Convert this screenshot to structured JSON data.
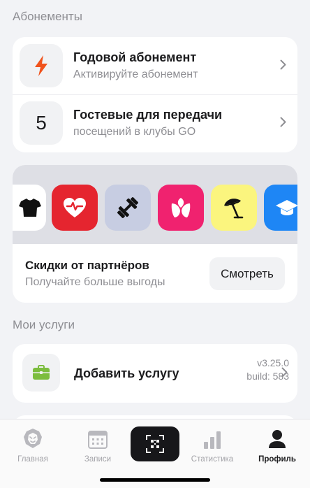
{
  "sections": {
    "subscriptions_title": "Абонементы",
    "services_title": "Мои услуги"
  },
  "subscriptions": [
    {
      "title": "Годовой абонемент",
      "subtitle": "Активируйте абонемент",
      "icon": "lightning-icon"
    },
    {
      "badge": "5",
      "title": "Гостевые для передачи",
      "subtitle": "посещений в клубы GO"
    }
  ],
  "partners": {
    "tiles": [
      {
        "icon": "tshirt-icon",
        "color": "#ffffff"
      },
      {
        "icon": "heart-pulse-icon",
        "color": "#e5252f"
      },
      {
        "icon": "dumbbell-icon",
        "color": "#c7cde2"
      },
      {
        "icon": "flower-icon",
        "color": "#f0226f"
      },
      {
        "icon": "beach-umbrella-icon",
        "color": "#fbf57e"
      },
      {
        "icon": "graduation-cap-icon",
        "color": "#1e86f5"
      }
    ],
    "title": "Скидки от партнёров",
    "subtitle": "Получайте больше выгоды",
    "button": "Смотреть"
  },
  "service": {
    "title": "Добавить услугу",
    "version": "v3.25.0",
    "build": "build: 583",
    "icon": "briefcase-icon"
  },
  "tabbar": {
    "items": [
      {
        "label": "Главная",
        "icon": "lion-icon",
        "active": false
      },
      {
        "label": "Записи",
        "icon": "calendar-icon",
        "active": false
      },
      {
        "label": "",
        "icon": "qr-scan-icon",
        "active": false
      },
      {
        "label": "Статистика",
        "icon": "bar-chart-icon",
        "active": false
      },
      {
        "label": "Профиль",
        "icon": "profile-icon",
        "active": true
      }
    ]
  },
  "colors": {
    "accent_orange": "#f0531c",
    "service_green": "#7cbd3e",
    "background": "#f2f3f6"
  }
}
